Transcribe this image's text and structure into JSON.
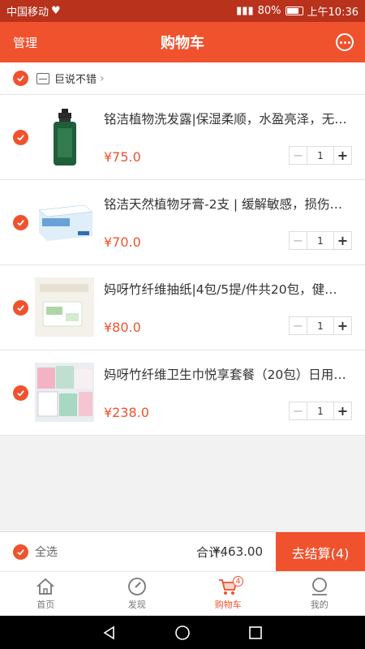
{
  "status": {
    "carrier": "中国移动",
    "battery": "80%",
    "time": "上午10:36"
  },
  "header": {
    "manage": "管理",
    "title": "购物车"
  },
  "shop": {
    "name": "巨说不错"
  },
  "items": [
    {
      "name": "铭洁植物洗发露|保湿柔顺，水盈亮泽，无硅油配方",
      "price": "¥75.0",
      "qty": "1"
    },
    {
      "name": "铭洁天然植物牙膏-2支 | 缓解敏感，损伤修护",
      "price": "¥70.0",
      "qty": "1"
    },
    {
      "name": "妈呀竹纤维抽纸|4包/5提/件共20包，健康环保",
      "price": "¥80.0",
      "qty": "1"
    },
    {
      "name": "妈呀竹纤维卫生巾悦享套餐（20包）日用夜用",
      "price": "¥238.0",
      "qty": "1"
    }
  ],
  "checkout": {
    "select_all": "全选",
    "total_label": "合计:",
    "total": "¥463.00",
    "pay_button": "去结算(4)"
  },
  "tabs": [
    {
      "label": "首页"
    },
    {
      "label": "发现"
    },
    {
      "label": "购物车",
      "badge": "4"
    },
    {
      "label": "我的"
    }
  ],
  "colors": {
    "accent": "#f0522e",
    "statusbar": "#b8321c"
  }
}
